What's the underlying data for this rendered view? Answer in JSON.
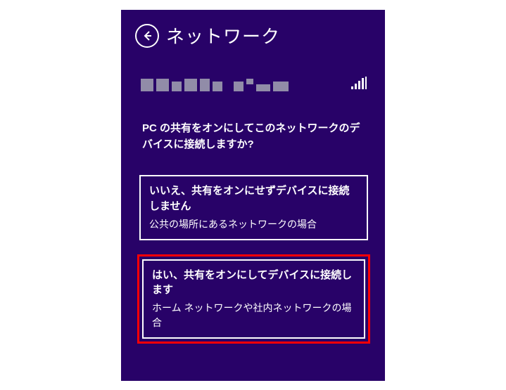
{
  "header": {
    "title": "ネットワーク"
  },
  "prompt": "PC の共有をオンにしてこのネットワークのデバイスに接続しますか?",
  "options": {
    "no": {
      "title": "いいえ、共有をオンにせずデバイスに接続しません",
      "subtitle": "公共の場所にあるネットワークの場合"
    },
    "yes": {
      "title": "はい、共有をオンにしてデバイスに接続します",
      "subtitle": "ホーム ネットワークや社内ネットワークの場合"
    }
  }
}
